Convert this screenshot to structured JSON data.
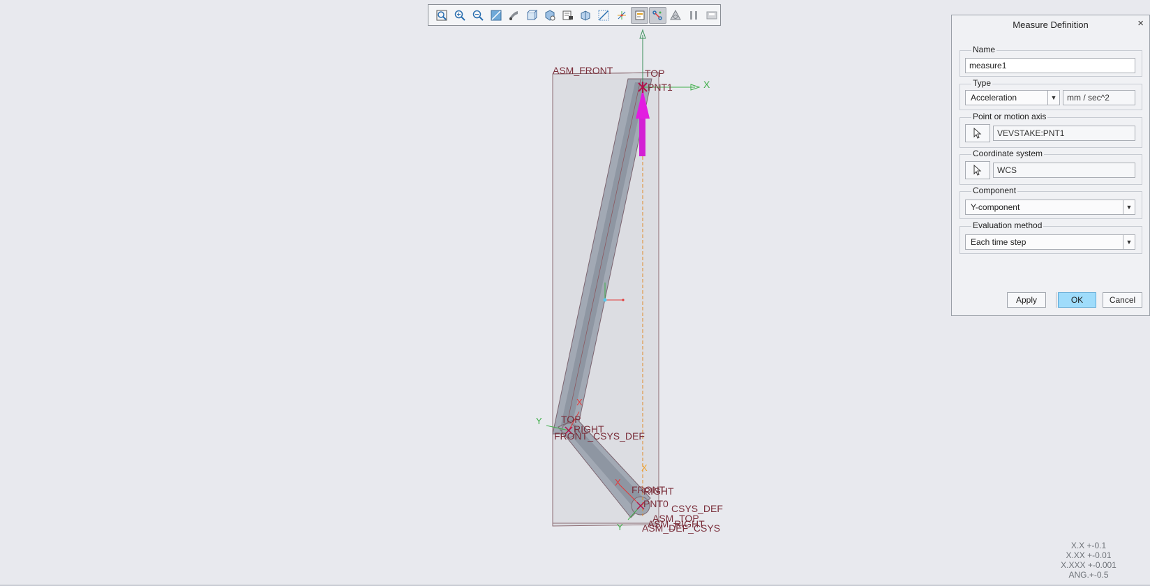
{
  "toolbar": {
    "icons": [
      "refit-icon",
      "zoom-in-icon",
      "zoom-out-icon",
      "repaint-icon",
      "display-style-icon",
      "saved-orientations-icon",
      "view-manager-icon",
      "named-views-icon",
      "perspective-icon",
      "annotation-display-icon",
      "datum-display-icon",
      "mechanism-display-icon",
      "motion-icon",
      "shading-icon",
      "pause-icon",
      "spin-center-icon"
    ],
    "active": [
      11,
      12
    ]
  },
  "viewport": {
    "labels": {
      "asm_front": "ASM_FRONT",
      "top": "TOP",
      "pnt1": "PNT1",
      "x_axis": "X",
      "y_axis": "Y",
      "x_lower": "X",
      "y_lower": "Y",
      "x_orange": "X",
      "top_lower": "TOP",
      "right_lower": "RIGHT",
      "front_csys_def": "FRONT_CSYS_DEF",
      "front_bottom": "FRONT",
      "right_bottom": "RIGHT",
      "pnt0": "PNT0",
      "csys_def_bottom": "CSYS_DEF",
      "asm_top": "ASM_TOP",
      "asm_def_csys": "ASM_DEF_CSYS",
      "asm_right": "ASM_RIGHT"
    }
  },
  "tolerances": [
    "X.X +-0.1",
    "X.XX +-0.01",
    "X.XXX +-0.001",
    "ANG.+-0.5"
  ],
  "dialog": {
    "title": "Measure Definition",
    "close": "×",
    "name_label": "Name",
    "name_value": "measure1",
    "type_label": "Type",
    "type_value": "Acceleration",
    "unit_value": "mm / sec^2",
    "point_label": "Point or motion axis",
    "point_value": "VEVSTAKE:PNT1",
    "csys_label": "Coordinate system",
    "csys_value": "WCS",
    "component_label": "Component",
    "component_value": "Y-component",
    "eval_label": "Evaluation method",
    "eval_value": "Each time step",
    "apply_label": "Apply",
    "ok_label": "OK",
    "cancel_label": "Cancel"
  },
  "colors": {
    "accent": "#9fdcfb",
    "arrow": "#e21de0",
    "datum": "#7a2e3a",
    "axis_green": "#3fae4a",
    "axis_red": "#e23a3a",
    "axis_orange": "#f0a22c"
  }
}
